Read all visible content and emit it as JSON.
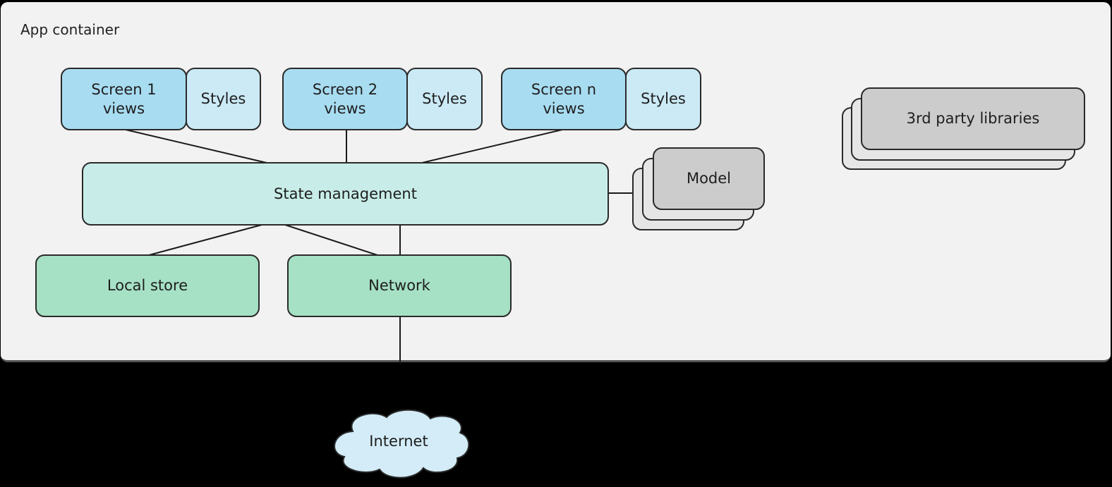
{
  "diagram": {
    "container_label": "App container",
    "screens": [
      {
        "views_label": "Screen 1\nviews",
        "styles_label": "Styles"
      },
      {
        "views_label": "Screen 2\nviews",
        "styles_label": "Styles"
      },
      {
        "views_label": "Screen n\nviews",
        "styles_label": "Styles"
      }
    ],
    "state_management": "State management",
    "model": "Model",
    "third_party": "3rd party libraries",
    "local_store": "Local store",
    "network": "Network",
    "internet": "Internet",
    "colors": {
      "background": "#000000",
      "container": "#f2f2f2",
      "screen_views": "#a8dcf1",
      "styles": "#cbeaf6",
      "state_management": "#c8ede8",
      "data_layer": "#a6e1c5",
      "model_libraries": "#cccccc",
      "internet_cloud": "#d3ecf8"
    }
  }
}
